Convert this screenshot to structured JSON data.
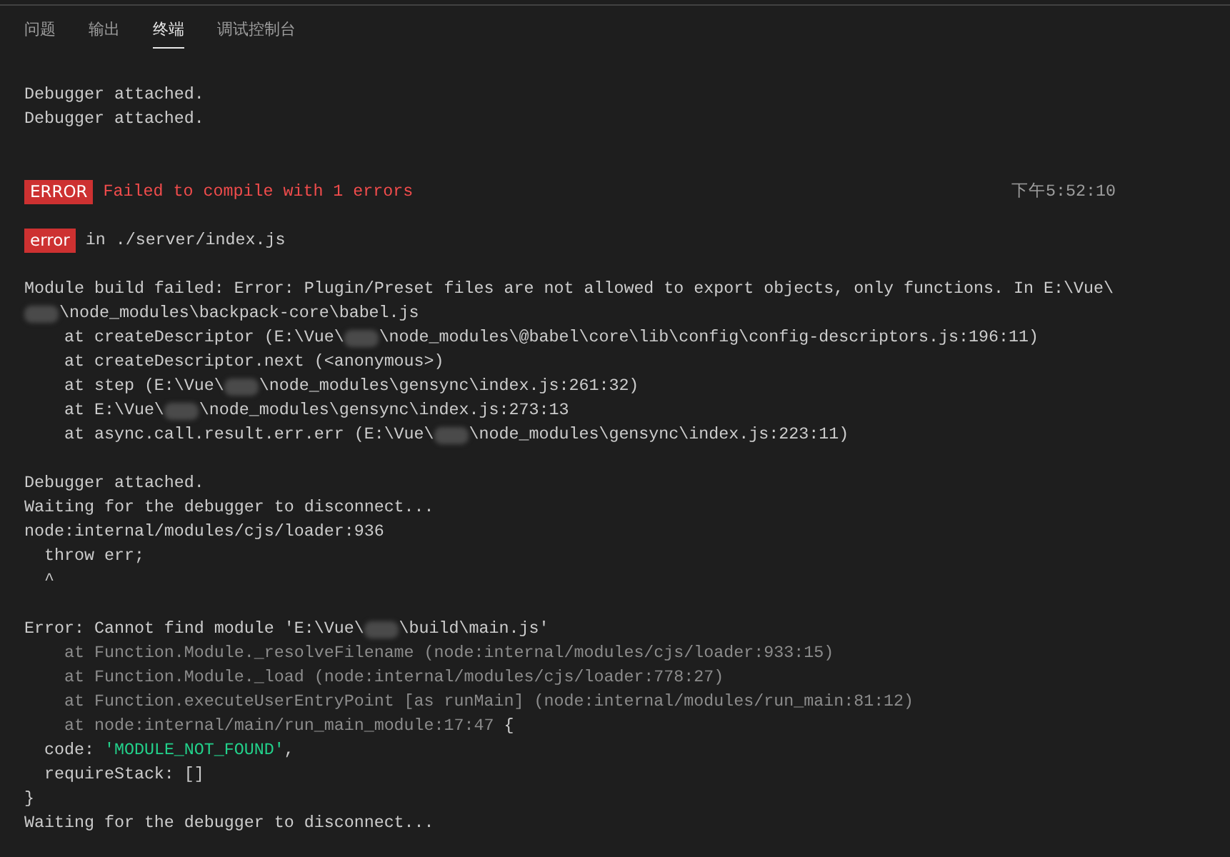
{
  "tabs": [
    {
      "label": "问题",
      "selected": false
    },
    {
      "label": "输出",
      "selected": false
    },
    {
      "label": "终端",
      "selected": true
    },
    {
      "label": "调试控制台",
      "selected": false
    }
  ],
  "terminal": {
    "lines": [
      {
        "kind": "blank"
      },
      {
        "kind": "text",
        "segments": [
          {
            "kind": "plain",
            "text": "Debugger attached."
          }
        ]
      },
      {
        "kind": "text",
        "segments": [
          {
            "kind": "plain",
            "text": "Debugger attached."
          }
        ]
      },
      {
        "kind": "blank"
      },
      {
        "kind": "blank"
      },
      {
        "kind": "badge",
        "badge": "ERROR",
        "segments": [
          {
            "kind": "error",
            "text": "Failed to compile with 1 errors"
          }
        ],
        "time": "下午5:52:10"
      },
      {
        "kind": "blank"
      },
      {
        "kind": "badge",
        "badge": "error",
        "segments": [
          {
            "kind": "plain",
            "text": "in ./server/index.js"
          }
        ]
      },
      {
        "kind": "blank"
      },
      {
        "kind": "text",
        "segments": [
          {
            "kind": "plain",
            "text": "Module build failed: Error: Plugin/Preset files are not allowed to export objects, only functions. In E:\\Vue\\"
          }
        ]
      },
      {
        "kind": "text",
        "segments": [
          {
            "kind": "redacted"
          },
          {
            "kind": "plain",
            "text": "\\node_modules\\backpack-core\\babel.js"
          }
        ]
      },
      {
        "kind": "text",
        "segments": [
          {
            "kind": "plain",
            "text": "    at createDescriptor (E:\\Vue\\"
          },
          {
            "kind": "redacted"
          },
          {
            "kind": "plain",
            "text": "\\node_modules\\@babel\\core\\lib\\config\\config-descriptors.js:196:11)"
          }
        ]
      },
      {
        "kind": "text",
        "segments": [
          {
            "kind": "plain",
            "text": "    at createDescriptor.next (<anonymous>)"
          }
        ]
      },
      {
        "kind": "text",
        "segments": [
          {
            "kind": "plain",
            "text": "    at step (E:\\Vue\\"
          },
          {
            "kind": "redacted"
          },
          {
            "kind": "plain",
            "text": "\\node_modules\\gensync\\index.js:261:32)"
          }
        ]
      },
      {
        "kind": "text",
        "segments": [
          {
            "kind": "plain",
            "text": "    at E:\\Vue\\"
          },
          {
            "kind": "redacted"
          },
          {
            "kind": "plain",
            "text": "\\node_modules\\gensync\\index.js:273:13"
          }
        ]
      },
      {
        "kind": "text",
        "segments": [
          {
            "kind": "plain",
            "text": "    at async.call.result.err.err (E:\\Vue\\"
          },
          {
            "kind": "redacted"
          },
          {
            "kind": "plain",
            "text": "\\node_modules\\gensync\\index.js:223:11)"
          }
        ]
      },
      {
        "kind": "blank"
      },
      {
        "kind": "text",
        "segments": [
          {
            "kind": "plain",
            "text": "Debugger attached."
          }
        ]
      },
      {
        "kind": "text",
        "segments": [
          {
            "kind": "plain",
            "text": "Waiting for the debugger to disconnect..."
          }
        ]
      },
      {
        "kind": "text",
        "segments": [
          {
            "kind": "plain",
            "text": "node:internal/modules/cjs/loader:936"
          }
        ]
      },
      {
        "kind": "text",
        "segments": [
          {
            "kind": "plain",
            "text": "  throw err;"
          }
        ]
      },
      {
        "kind": "text",
        "segments": [
          {
            "kind": "plain",
            "text": "  ^"
          }
        ]
      },
      {
        "kind": "blank"
      },
      {
        "kind": "text",
        "segments": [
          {
            "kind": "plain",
            "text": "Error: Cannot find module 'E:\\Vue\\"
          },
          {
            "kind": "redacted"
          },
          {
            "kind": "plain",
            "text": "\\build\\main.js'"
          }
        ]
      },
      {
        "kind": "text",
        "segments": [
          {
            "kind": "dim",
            "text": "    at Function.Module._resolveFilename (node:internal/modules/cjs/loader:933:15)"
          }
        ]
      },
      {
        "kind": "text",
        "segments": [
          {
            "kind": "dim",
            "text": "    at Function.Module._load (node:internal/modules/cjs/loader:778:27)"
          }
        ]
      },
      {
        "kind": "text",
        "segments": [
          {
            "kind": "dim",
            "text": "    at Function.executeUserEntryPoint [as runMain] (node:internal/modules/run_main:81:12)"
          }
        ]
      },
      {
        "kind": "text",
        "segments": [
          {
            "kind": "dim",
            "text": "    at node:internal/main/run_main_module:17:47 "
          },
          {
            "kind": "plain",
            "text": "{"
          }
        ]
      },
      {
        "kind": "text",
        "segments": [
          {
            "kind": "plain",
            "text": "  code: "
          },
          {
            "kind": "string",
            "text": "'MODULE_NOT_FOUND'"
          },
          {
            "kind": "plain",
            "text": ","
          }
        ]
      },
      {
        "kind": "text",
        "segments": [
          {
            "kind": "plain",
            "text": "  requireStack: []"
          }
        ]
      },
      {
        "kind": "text",
        "segments": [
          {
            "kind": "plain",
            "text": "}"
          }
        ]
      },
      {
        "kind": "text",
        "segments": [
          {
            "kind": "plain",
            "text": "Waiting for the debugger to disconnect..."
          }
        ]
      }
    ]
  }
}
